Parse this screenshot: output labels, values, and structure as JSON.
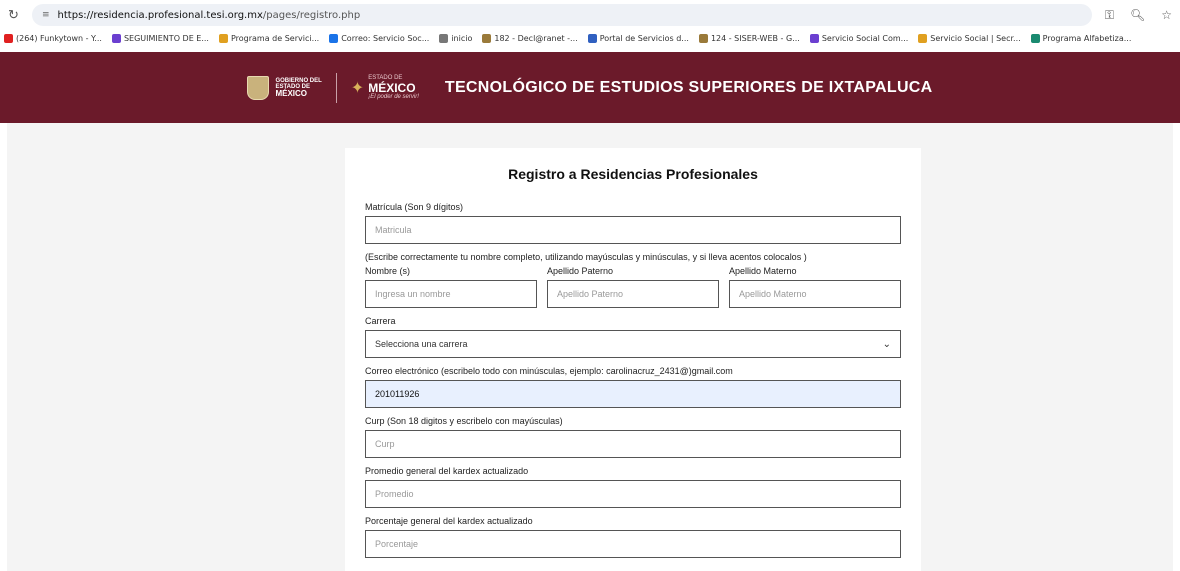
{
  "browser": {
    "url_host": "https://residencia.profesional.tesi.org.mx",
    "url_path": "/pages/registro.php",
    "bookmarks": [
      {
        "label": "(264) Funkytown - Y...",
        "color": "#e02020"
      },
      {
        "label": "SEGUIMIENTO DE E...",
        "color": "#6b3fd0"
      },
      {
        "label": "Programa de Servici...",
        "color": "#e0a020"
      },
      {
        "label": "Correo: Servicio Soc...",
        "color": "#1a73e8"
      },
      {
        "label": "inicio",
        "color": "#777777"
      },
      {
        "label": "182 - Decl@ranet -...",
        "color": "#9a7a3a"
      },
      {
        "label": "Portal de Servicios d...",
        "color": "#3060c0"
      },
      {
        "label": "124 - SISER-WEB - G...",
        "color": "#9a7a3a"
      },
      {
        "label": "Servicio Social Com...",
        "color": "#6b3fd0"
      },
      {
        "label": "Servicio Social | Secr...",
        "color": "#e0a020"
      },
      {
        "label": "Programa Alfabetiza...",
        "color": "#1a8a70"
      }
    ]
  },
  "header": {
    "gob_line1": "GOBIERNO DEL",
    "gob_line2": "ESTADO DE",
    "gob_line3": "MÉXICO",
    "edomex_top": "ESTADO DE",
    "edomex_main": "MÉXICO",
    "edomex_slogan": "¡El poder de servir!",
    "title": "TECNOLÓGICO DE ESTUDIOS SUPERIORES DE IXTAPALUCA",
    "color": "#6b1a2a"
  },
  "form": {
    "title": "Registro a Residencias Profesionales",
    "matricula_label": "Matrícula (Son 9 dígitos)",
    "matricula_placeholder": "Matricula",
    "name_instruction": "(Escribe correctamente tu nombre completo, utilizando mayúsculas y minúsculas, y si lleva acentos colocalos )",
    "nombre_label": "Nombre (s)",
    "nombre_placeholder": "Ingresa un nombre",
    "paterno_label": "Apellido Paterno",
    "paterno_placeholder": "Apellido Paterno",
    "materno_label": "Apellido Materno",
    "materno_placeholder": "Apellido Materno",
    "carrera_label": "Carrera",
    "carrera_selected": "Selecciona una carrera",
    "correo_label": "Correo electrónico (escribelo todo con minúsculas, ejemplo: carolinacruz_2431@)gmail.com",
    "correo_value": "201011926",
    "curp_label": "Curp (Son 18 digitos y escribelo con mayúsculas)",
    "curp_placeholder": "Curp",
    "promedio_label": "Promedio general del kardex actualizado",
    "promedio_placeholder": "Promedio",
    "porcentaje_label": "Porcentaje general del kardex actualizado",
    "porcentaje_placeholder": "Porcentaje"
  }
}
